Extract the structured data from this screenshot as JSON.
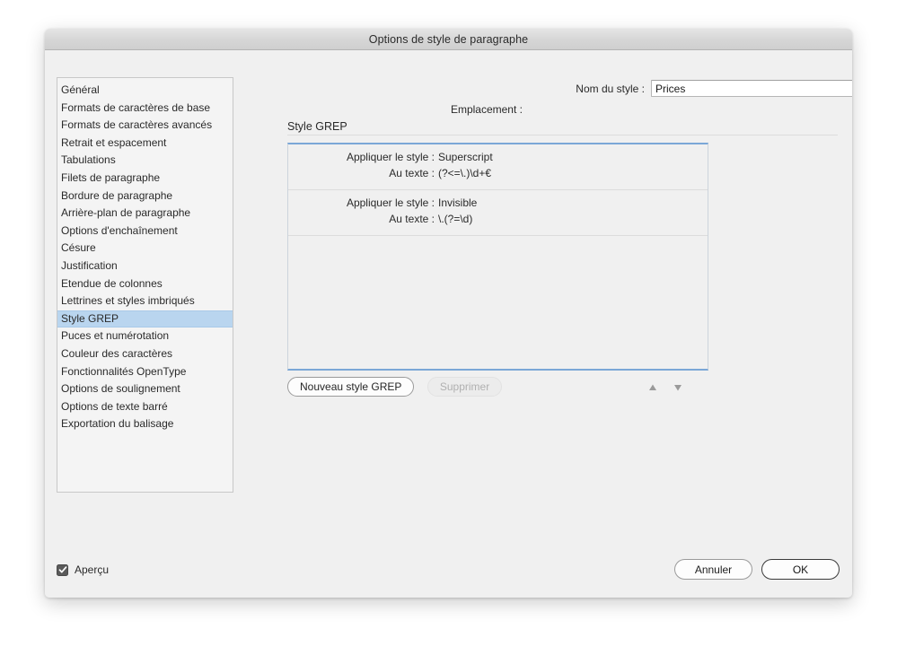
{
  "window": {
    "title": "Options de style de paragraphe"
  },
  "sidebar": {
    "items": [
      {
        "label": "Général",
        "selected": false
      },
      {
        "label": "Formats de caractères de base",
        "selected": false
      },
      {
        "label": "Formats de caractères avancés",
        "selected": false
      },
      {
        "label": "Retrait et espacement",
        "selected": false
      },
      {
        "label": "Tabulations",
        "selected": false
      },
      {
        "label": "Filets de paragraphe",
        "selected": false
      },
      {
        "label": "Bordure de paragraphe",
        "selected": false
      },
      {
        "label": "Arrière-plan de paragraphe",
        "selected": false
      },
      {
        "label": "Options d'enchaînement",
        "selected": false
      },
      {
        "label": "Césure",
        "selected": false
      },
      {
        "label": "Justification",
        "selected": false
      },
      {
        "label": "Etendue de colonnes",
        "selected": false
      },
      {
        "label": "Lettrines et styles imbriqués",
        "selected": false
      },
      {
        "label": "Style GREP",
        "selected": true
      },
      {
        "label": "Puces et numérotation",
        "selected": false
      },
      {
        "label": "Couleur des caractères",
        "selected": false
      },
      {
        "label": "Fonctionnalités OpenType",
        "selected": false
      },
      {
        "label": "Options de soulignement",
        "selected": false
      },
      {
        "label": "Options de texte barré",
        "selected": false
      },
      {
        "label": "Exportation du balisage",
        "selected": false
      }
    ]
  },
  "header": {
    "style_name_label": "Nom du style :",
    "style_name_value": "Prices",
    "location_label": "Emplacement :",
    "location_value": ""
  },
  "section": {
    "heading": "Style GREP"
  },
  "grep_styles": {
    "entries": [
      {
        "apply_style_label": "Appliquer le style :",
        "apply_style_value": "Superscript",
        "to_text_label": "Au texte :",
        "to_text_value": "(?<=\\.)\\d+€"
      },
      {
        "apply_style_label": "Appliquer le style :",
        "apply_style_value": "Invisible",
        "to_text_label": "Au texte :",
        "to_text_value": "\\.(?=\\d)"
      }
    ]
  },
  "list_toolbar": {
    "new_button": "Nouveau style GREP",
    "delete_button": "Supprimer",
    "delete_disabled": true,
    "move_up_icon": "triangle-up-icon",
    "move_down_icon": "triangle-down-icon"
  },
  "footer": {
    "preview_label": "Aperçu",
    "preview_checked": true,
    "cancel_button": "Annuler",
    "ok_button": "OK"
  },
  "colors": {
    "selection_blue": "#b9d5ef",
    "focus_border_blue": "#7ba7d7",
    "dialog_background": "#f0f0f0",
    "titlebar_gray": "#d6d6d6"
  }
}
